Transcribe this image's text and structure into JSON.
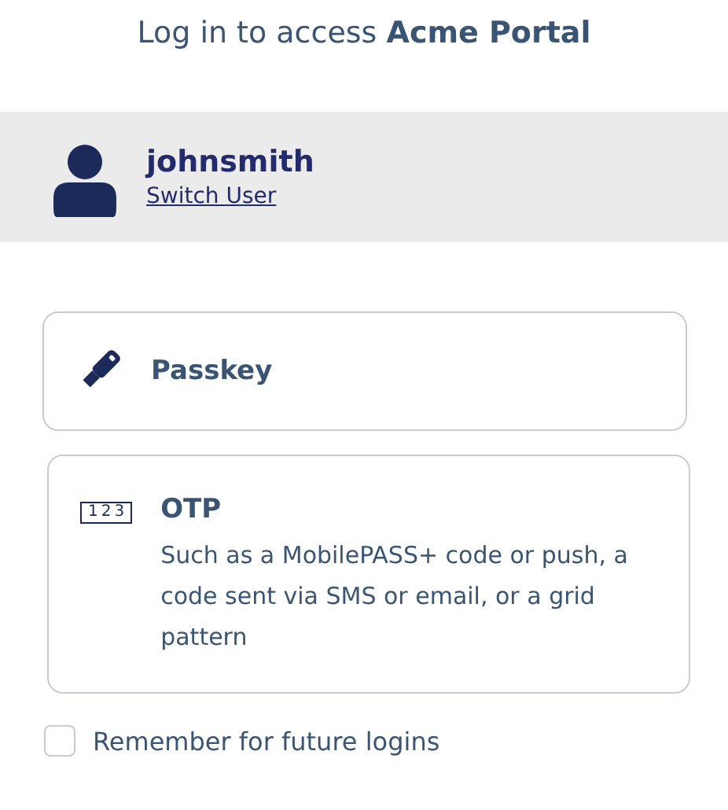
{
  "title": "Log in to access **Acme Portal**",
  "user": {
    "name": "johnsmith",
    "switch_link": "Switch User"
  },
  "methods": [
    {
      "kind": "passkey",
      "label": "Passkey"
    },
    {
      "kind": "otp",
      "label": "OTP",
      "icon_text": "123",
      "description": "Such as a MobilePASS+ code or push, a code sent via SMS or email, or a grid pattern"
    }
  ],
  "remember": {
    "label": "Remember for future logins",
    "checked": false
  }
}
